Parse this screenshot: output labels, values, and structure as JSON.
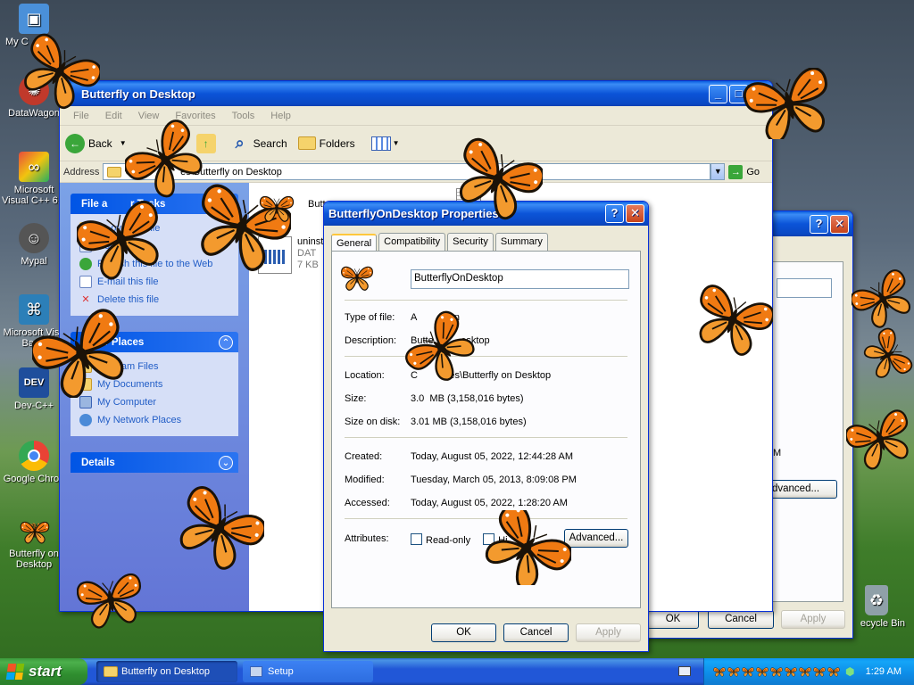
{
  "desktop": {
    "icons": [
      {
        "label": "My C",
        "color": "#4a90d9"
      },
      {
        "label": "DataWagon",
        "color": "#c0392b"
      },
      {
        "label": "Microsoft Visual C++ 6.0",
        "color": "#d35400"
      },
      {
        "label": "Mypal",
        "color": "#555555"
      },
      {
        "label": "Microsoft Visu Basic",
        "color": "#2c7fb8"
      },
      {
        "label": "Dev-C++",
        "color": "#1f4e9c"
      },
      {
        "label": "Google Chron",
        "color": "#34a853"
      },
      {
        "label": "Butterfly on Desktop",
        "color": "#e67e22"
      },
      {
        "label": "ecycle Bin",
        "color": "#8fa0a8"
      }
    ]
  },
  "explorer": {
    "title": "Butterfly on Desktop",
    "menu": [
      "File",
      "Edit",
      "View",
      "Favorites",
      "Tools",
      "Help"
    ],
    "toolbar": {
      "back": "Back",
      "search": "Search",
      "folders": "Folders"
    },
    "address": {
      "label": "Address",
      "value": "C:\\Pr            es\\Butterfly on Desktop",
      "go": "Go"
    },
    "tasks_panel": {
      "title": "File a        r Tasks",
      "items": [
        "     ove this file",
        "Copy this file",
        "Publish this file to the Web",
        "E-mail this file",
        "Delete this file"
      ]
    },
    "other_places": {
      "title": "Other Places",
      "items": [
        "Program Files",
        "My Documents",
        "My Computer",
        "My Network Places"
      ]
    },
    "details": {
      "title": "Details"
    },
    "files": [
      {
        "name": "Butte",
        "sub1": "",
        "sub2": ""
      },
      {
        "name": "uninst",
        "sub1": "DAT",
        "sub2": "7 KB"
      },
      {
        "name": "lic",
        "sub1": "",
        "sub2": ""
      }
    ]
  },
  "setup_dialog": {
    "ok": "OK",
    "cancel": "Cancel",
    "apply": "Apply",
    "advanced": "dvanced...",
    "fragment": "M"
  },
  "properties": {
    "title": "ButterflyOnDesktop Properties",
    "tabs": [
      "General",
      "Compatibility",
      "Security",
      "Summary"
    ],
    "name_value": "ButterflyOnDesktop",
    "rows": {
      "type": {
        "k": "Type of file:",
        "v": "A          tion"
      },
      "desc": {
        "k": "Description:",
        "v": "Butte          esktop"
      },
      "loc": {
        "k": "Location:",
        "v": "C          iles\\Butterfly on Desktop"
      },
      "size": {
        "k": "Size:",
        "v": "3.0  MB (3,158,016 bytes)"
      },
      "disk": {
        "k": "Size on disk:",
        "v": "3.01 MB (3,158,016 bytes)"
      },
      "created": {
        "k": "Created:",
        "v": "Today, August 05, 2022, 12:44:28 AM"
      },
      "modified": {
        "k": "Modified:",
        "v": "Tuesday, March 05, 2013, 8:09:08 PM"
      },
      "accessed": {
        "k": "Accessed:",
        "v": "Today, August 05, 2022, 1:28:20 AM"
      }
    },
    "attributes": {
      "k": "Attributes:",
      "readonly": "Read-only",
      "hidden": "Hi    n",
      "advanced": "Advanced..."
    },
    "buttons": {
      "ok": "OK",
      "cancel": "Cancel",
      "apply": "Apply"
    }
  },
  "taskbar": {
    "start": "start",
    "tasks": [
      {
        "label": "Butterfly on Desktop"
      },
      {
        "label": "Setup"
      }
    ],
    "clock": "1:29 AM"
  },
  "colors": {
    "butterfly_orange": "#f07a12",
    "butterfly_dark": "#1a1208",
    "xp_blue": "#0b54d8"
  }
}
